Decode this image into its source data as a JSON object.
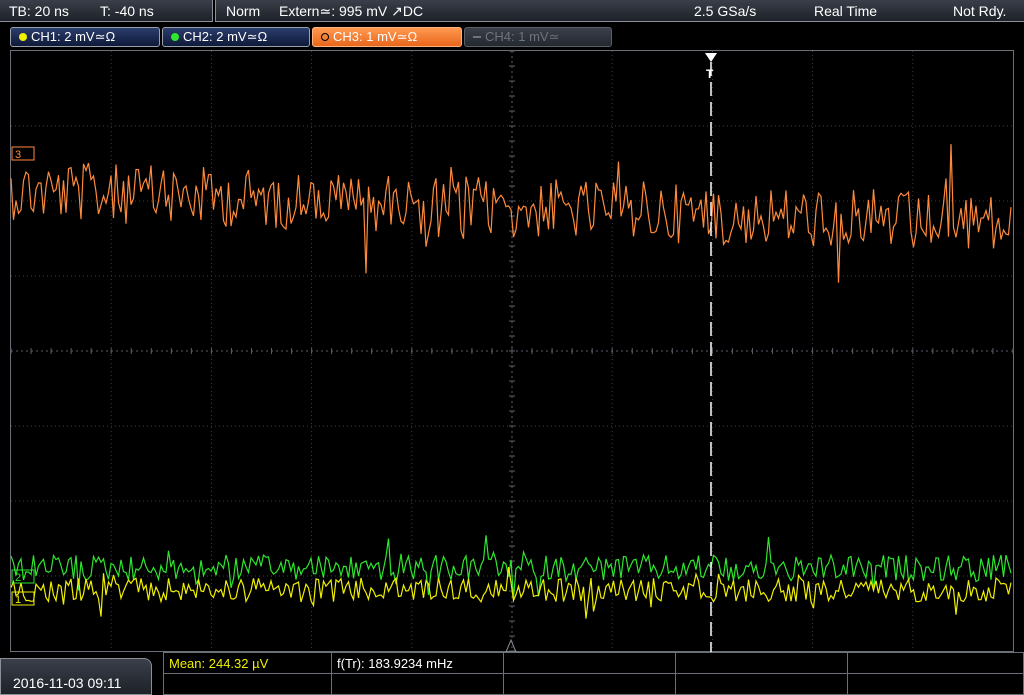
{
  "timebase": {
    "tb_label": "TB: 20 ns",
    "trigger_offset_label": "T: -40 ns"
  },
  "status_bar": {
    "mode": "Norm",
    "trigger_source": "Extern≃: 995 mV ↗DC",
    "sample_rate": "2.5 GSa/s",
    "acquisition": "Real Time",
    "state": "Not Rdy."
  },
  "channels": [
    {
      "label": "CH1: 2 mV≃Ω",
      "color": "#f0f000",
      "active": true
    },
    {
      "label": "CH2: 2 mV≃Ω",
      "color": "#2ee62e",
      "active": true
    },
    {
      "label": "CH3: 1 mV≃Ω",
      "color": "#ff8a3c",
      "active": true,
      "selected": true
    },
    {
      "label": "CH4: 1 mV≃",
      "color": "#6f747c",
      "active": false
    }
  ],
  "trigger_marker": {
    "label": "T"
  },
  "channel_markers": {
    "ch1": "1",
    "ch2": "2",
    "ch3": "3"
  },
  "footer": {
    "datetime": "2016-11-03 09:11"
  },
  "measurements": [
    {
      "label": "Mean: 244.32 µV",
      "color": "#f0f000"
    },
    {
      "label": "f(Tr): 183.9234 mHz",
      "color": "#ffffff"
    }
  ]
}
